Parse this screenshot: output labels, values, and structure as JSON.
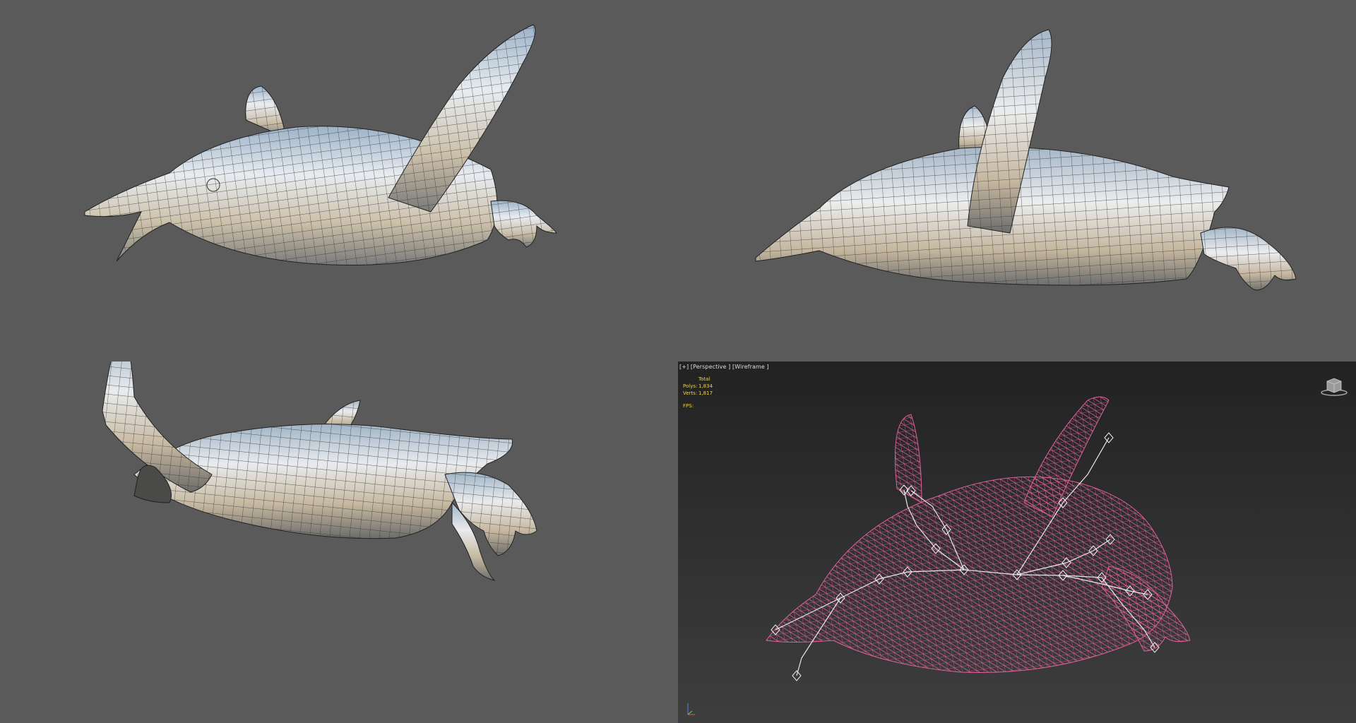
{
  "viewports": {
    "top_left": {
      "model": "penguin-shaded"
    },
    "top_right": {
      "model": "penguin-shaded"
    },
    "bottom_left": {
      "model": "penguin-shaded"
    },
    "bottom_right": {
      "label": "[+] [Perspective ] [Wireframe ]",
      "stats": {
        "header": "Total",
        "polys_label": "Polys:",
        "polys_value": "1,834",
        "verts_label": "Verts:",
        "verts_value": "1,817",
        "fps_label": "FPS:"
      },
      "wire_color": "#e0609a",
      "bone_color": "#e8e8e8"
    }
  },
  "colors": {
    "background": "#5a5a5a",
    "viewport_active_bg": "#2a2a2a",
    "stats_text": "#e6d35a"
  },
  "icons": [
    "viewcube-icon",
    "axis-gizmo-icon"
  ]
}
